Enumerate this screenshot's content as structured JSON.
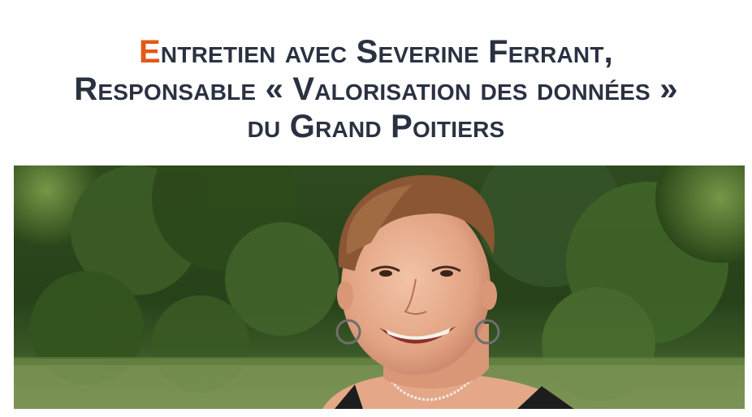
{
  "article": {
    "title": {
      "first_letter": "E",
      "line1_rest": "ntretien avec Severine Ferrant,",
      "line2": "Responsable « Valorisation des données »",
      "line3": "du Grand Poitiers"
    },
    "accent_color": "#e15a17",
    "title_color": "#2a3242"
  },
  "photo": {
    "subject": "portrait of a smiling woman with short brown hair and hoop earrings, trees and lawn in background"
  }
}
